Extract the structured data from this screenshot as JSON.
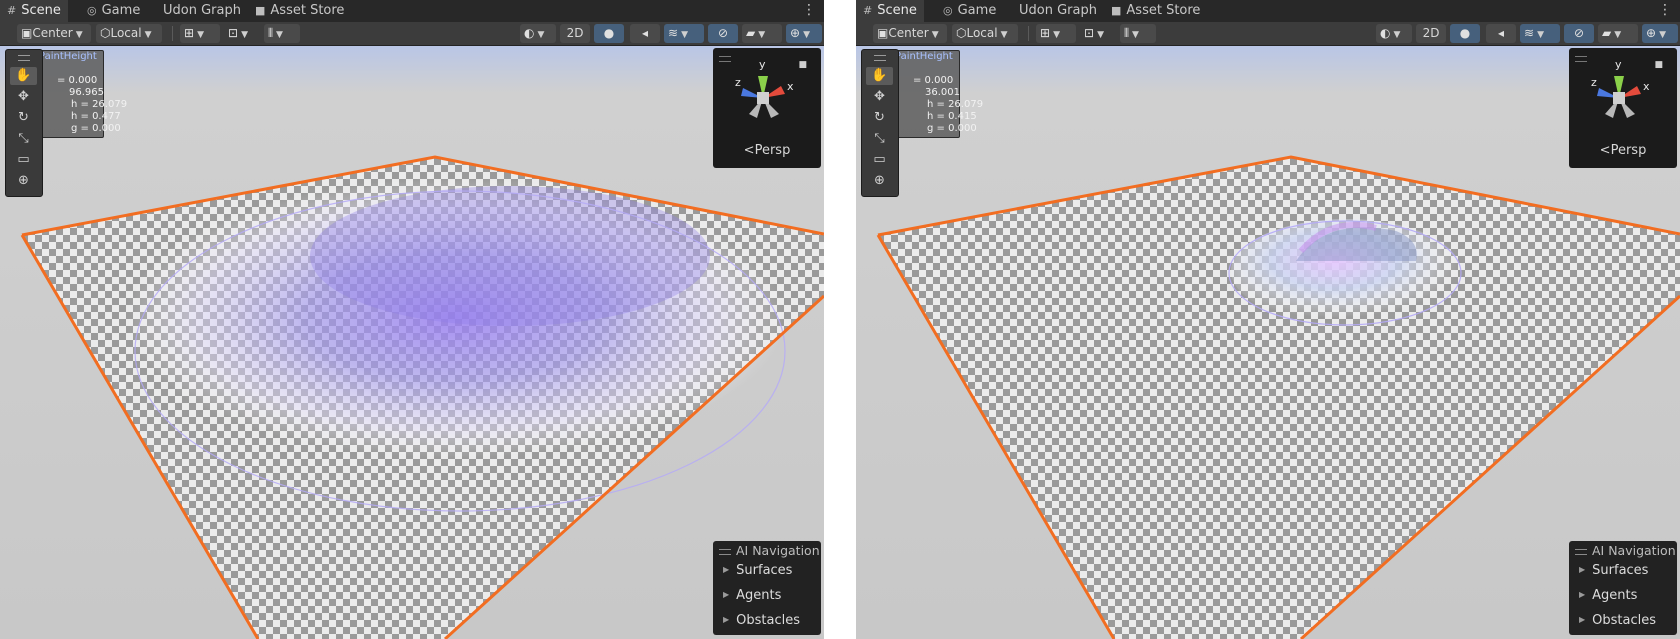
{
  "panels": [
    {
      "tabs": [
        {
          "label": "Scene",
          "icon": "grid-icon",
          "active": true
        },
        {
          "label": "Game",
          "icon": "gamepad-icon",
          "active": false
        },
        {
          "label": "Udon Graph",
          "icon": "",
          "active": false
        },
        {
          "label": "Asset Store",
          "icon": "shopping-bag-icon",
          "active": false
        }
      ],
      "toolbar": {
        "pivot": "Center",
        "space": "Local",
        "mode_2d": "2D"
      },
      "overlay": {
        "title": "PaintHeight",
        "lines": [
          "= 0.000",
          "96.965",
          "h = 26.079",
          "h = 0.477",
          "g = 0.000"
        ]
      },
      "gizmo": {
        "y": "y",
        "x": "x",
        "z": "z",
        "view_label": "Persp"
      },
      "ai_navigation": {
        "title": "AI Navigation",
        "items": [
          "Surfaces",
          "Agents",
          "Obstacles"
        ]
      }
    },
    {
      "tabs": [
        {
          "label": "Scene",
          "icon": "grid-icon",
          "active": true
        },
        {
          "label": "Game",
          "icon": "gamepad-icon",
          "active": false
        },
        {
          "label": "Udon Graph",
          "icon": "",
          "active": false
        },
        {
          "label": "Asset Store",
          "icon": "shopping-bag-icon",
          "active": false
        }
      ],
      "toolbar": {
        "pivot": "Center",
        "space": "Local",
        "mode_2d": "2D"
      },
      "overlay": {
        "title": "PaintHeight",
        "lines": [
          "= 0.000",
          "36.001",
          "h = 26.079",
          "h = 0.415",
          "g = 0.000"
        ]
      },
      "gizmo": {
        "y": "y",
        "x": "x",
        "z": "z",
        "view_label": "Persp"
      },
      "ai_navigation": {
        "title": "AI Navigation",
        "items": [
          "Surfaces",
          "Agents",
          "Obstacles"
        ]
      }
    }
  ],
  "colors": {
    "selection_outline": "#f26d21",
    "brush": "#a58cf5",
    "toolbar_active": "#46607c"
  }
}
